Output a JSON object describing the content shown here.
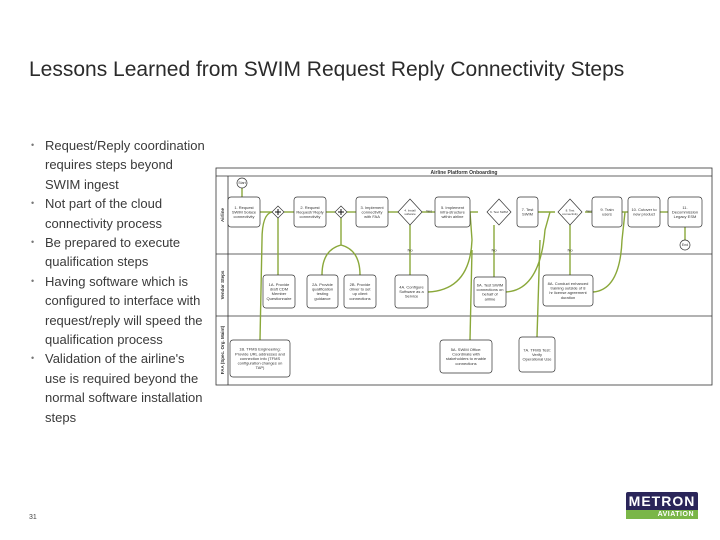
{
  "title": "Lessons Learned from SWIM Request Reply Connectivity Steps",
  "bullets": [
    "Request/Reply coordination requires steps beyond SWIM ingest",
    "Not part of the cloud connectivity process",
    "Be prepared to execute qualification steps",
    "Having software which is configured to interface with request/reply will speed the qualification process",
    "Validation of the airline's use is required beyond the normal software installation steps"
  ],
  "page_number": "31",
  "logo": {
    "top": "METRON",
    "bottom": "AVIATION",
    "colors": {
      "navy": "#2a2559",
      "green": "#7ab648"
    }
  },
  "diagram": {
    "header": "Airline Platform Onboarding",
    "lanes": [
      "Airline",
      "Vendor Steps",
      "FAA (Spec. Org. Maint)"
    ],
    "start": "Start",
    "end": "End",
    "steps": {
      "s1": "1. Request SWIM Solace connectivity",
      "s2": "2. Request Request/ Reply connectivity",
      "s3": "3. Implement connectivity with FAA",
      "d4": "4. Install software",
      "s5": "5. Implement infra-structure within airline",
      "d6": "6. Test SWIM",
      "s7": "7. Test SWIM",
      "d8": "8. Test connectivity",
      "s9": "9. Train users",
      "s10": "10. Cutover to new product",
      "s11": "11. Decommission Legacy ESM",
      "s1a": "1A. Provide draft CDM Member Questionnaire",
      "s2a": "2A. Provide qualification testing guidance",
      "s2b": "2B. Provide driver to set up client connections",
      "s4a": "4A. Configure Software as a Service",
      "s6a": "6A. Test SWIM connections on behalf of airline",
      "s8a": "8A. Conduct enhanced training outside of 8 hr license agreement duration",
      "s1b": "1B. TFMS Engineering: Provide URL addresses and connection info (TFMS configuration changes on TAP)",
      "s5a": "5A. SWIM Office: Coordinate with stakeholders to enable connections",
      "s7a": "7A. TFMS Test: Verify Operational Use"
    },
    "labels": {
      "yes": "Yes",
      "no": "No"
    },
    "colors": {
      "arrow": "#8aa83a",
      "line": "#333333"
    }
  }
}
